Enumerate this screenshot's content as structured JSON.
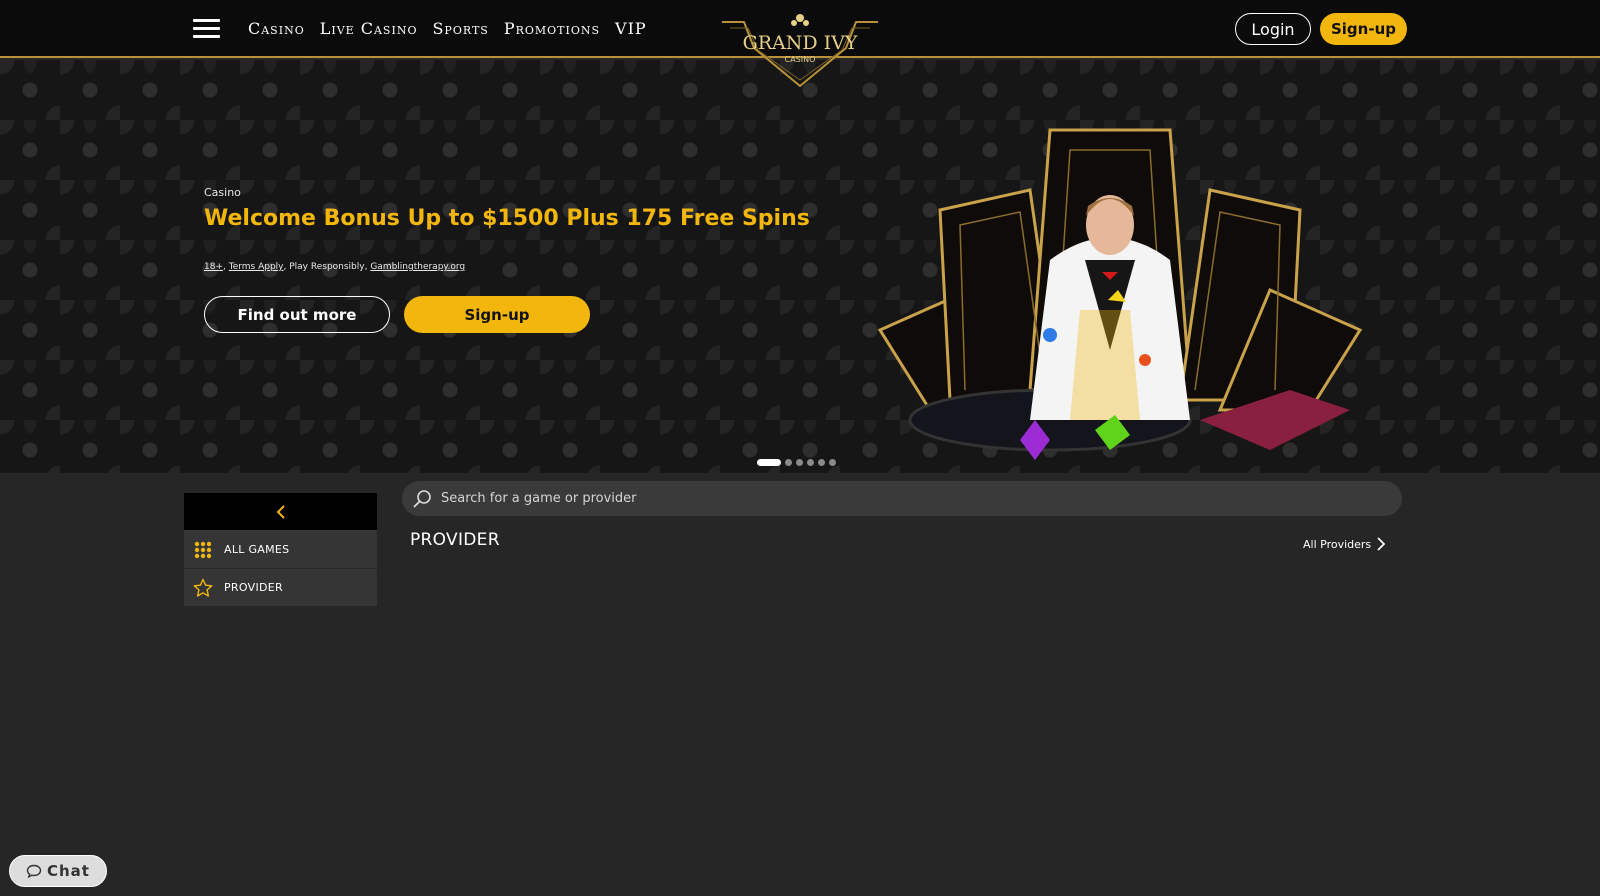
{
  "header": {
    "nav": [
      "Casino",
      "Live Casino",
      "Sports",
      "Promotions",
      "VIP"
    ],
    "logo": {
      "top": "GRAND IVY",
      "sub": "CASINO"
    },
    "login_label": "Login",
    "signup_label": "Sign-up"
  },
  "hero": {
    "category": "Casino",
    "title": "Welcome Bonus Up to $1500 Plus 175 Free Spins",
    "legal": {
      "age": "18+",
      "terms": "Terms Apply",
      "mid": ", Play Responsibly, ",
      "link": "Gamblingtherapy.org"
    },
    "find_out_label": "Find out more",
    "signup_label": "Sign-up",
    "slides": 6,
    "active_slide": 1
  },
  "sidebar": {
    "back_icon": "chevron-left-icon",
    "items": [
      {
        "label": "ALL GAMES",
        "icon": "grid-icon"
      },
      {
        "label": "PROVIDER",
        "icon": "star-icon"
      }
    ]
  },
  "search": {
    "placeholder": "Search for a game or provider"
  },
  "main": {
    "section_title": "PROVIDER",
    "all_providers_label": "All Providers"
  },
  "chat": {
    "label": "Chat"
  },
  "colors": {
    "accent": "#f2b60d",
    "header_bg": "#0b0b0b",
    "page_bg": "#262626",
    "gold_border": "#b8913a"
  }
}
